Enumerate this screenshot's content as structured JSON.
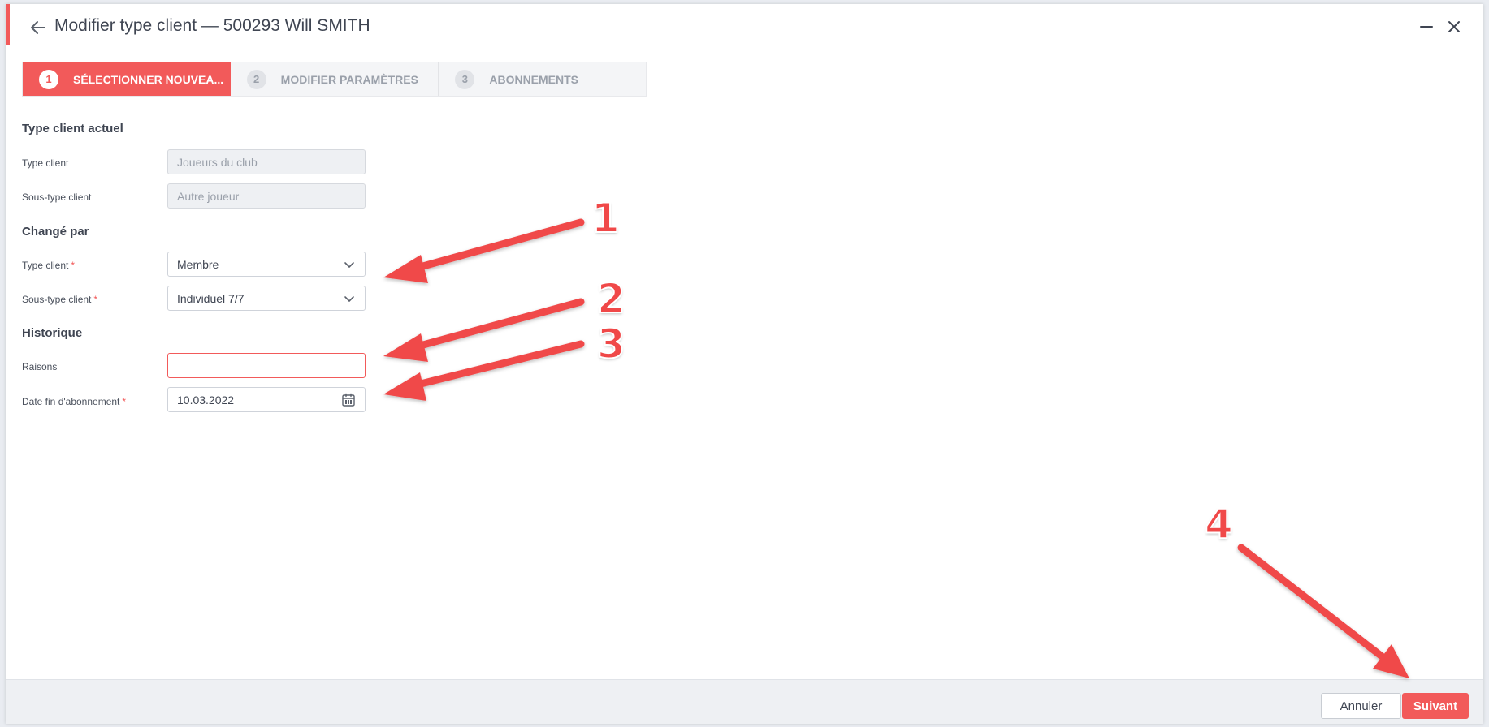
{
  "header": {
    "title": "Modifier type client — 500293 Will SMITH",
    "back_icon": "arrow-left-icon",
    "minimize_icon": "minimize-icon",
    "close_icon": "close-icon"
  },
  "stepper": {
    "steps": [
      {
        "number": "1",
        "label": "SÉLECTIONNER NOUVEA...",
        "active": true
      },
      {
        "number": "2",
        "label": "MODIFIER PARAMÈTRES",
        "active": false
      },
      {
        "number": "3",
        "label": "ABONNEMENTS",
        "active": false
      }
    ]
  },
  "current": {
    "section_title": "Type client actuel",
    "type_label": "Type client",
    "type_placeholder": "Joueurs du club",
    "subtype_label": "Sous-type client",
    "subtype_placeholder": "Autre joueur"
  },
  "changed": {
    "section_title": "Changé par",
    "type_label": "Type client",
    "type_value": "Membre",
    "subtype_label": "Sous-type client",
    "subtype_value": "Individuel 7/7",
    "required_mark": "*"
  },
  "history": {
    "section_title": "Historique",
    "reasons_label": "Raisons",
    "reasons_value": "",
    "end_date_label": "Date fin d'abonnement",
    "end_date_value": "10.03.2022",
    "required_mark": "*"
  },
  "footer": {
    "cancel_label": "Annuler",
    "next_label": "Suivant"
  },
  "annotations": [
    "1",
    "2",
    "3",
    "4"
  ],
  "colors": {
    "accent": "#f25a5a",
    "annotation": "#f04848"
  }
}
